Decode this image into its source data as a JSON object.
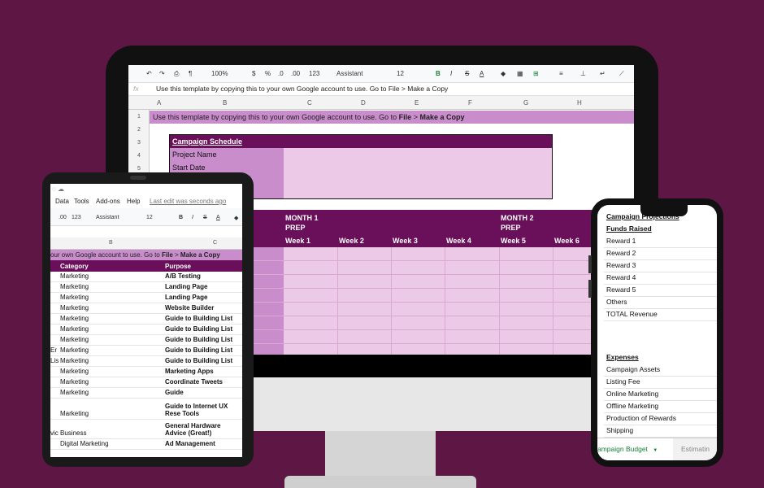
{
  "monitor": {
    "toolbar": {
      "zoom": "100%",
      "currency": "$",
      "percent": "%",
      "dec_decrease": ".0",
      "dec_increase": ".00",
      "format": "123",
      "font": "Assistant",
      "font_size": "12",
      "bold": "B",
      "italic": "I",
      "strike": "S",
      "text_color": "A"
    },
    "formula_bar": {
      "fx": "fx",
      "content": "Use this template by copying this to your own Google account to use.  Go to File > Make a Copy"
    },
    "columns": [
      "A",
      "B",
      "C",
      "D",
      "E",
      "F",
      "G",
      "H"
    ],
    "rows": [
      "1",
      "2",
      "3",
      "4",
      "5"
    ],
    "banner": {
      "text": "Use this template by copying this to your own Google account to use.  Go to ",
      "file": "File",
      "sep": " > ",
      "copy": "Make a Copy"
    },
    "schedule": {
      "title": "Campaign Schedule",
      "project_name": "Project Name",
      "start_date": "Start Date"
    },
    "months": {
      "month1": "MONTH 1",
      "prep": "PREP",
      "month2": "MONTH 2",
      "prep2": "PREP"
    },
    "weeks": [
      "Week 1",
      "Week 2",
      "Week 3",
      "Week 4",
      "Week 5",
      "Week 6"
    ]
  },
  "tablet": {
    "menu": [
      "Data",
      "Tools",
      "Add-ons",
      "Help"
    ],
    "last_edit": "Last edit was seconds ago",
    "toolbar": {
      "dec": ".00",
      "format": "123",
      "font": "Assistant",
      "size": "12",
      "bold": "B",
      "italic": "I",
      "strike": "S",
      "color": "A"
    },
    "columns": [
      "B",
      "C"
    ],
    "banner": {
      "text": "our own Google account to use.  Go to ",
      "file": "File",
      "sep": " > ",
      "copy": "Make a Copy"
    },
    "headers": {
      "category": "Category",
      "purpose": "Purpose"
    },
    "rows": [
      {
        "frag": "",
        "category": "Marketing",
        "purpose": "A/B Testing"
      },
      {
        "frag": "",
        "category": "Marketing",
        "purpose": "Landing Page"
      },
      {
        "frag": "",
        "category": "Marketing",
        "purpose": "Landing Page"
      },
      {
        "frag": "",
        "category": "Marketing",
        "purpose": "Website Builder"
      },
      {
        "frag": "",
        "category": "Marketing",
        "purpose": "Guide to Building List"
      },
      {
        "frag": "",
        "category": "Marketing",
        "purpose": "Guide to Building List"
      },
      {
        "frag": "",
        "category": "Marketing",
        "purpose": "Guide to Building List"
      },
      {
        "frag": "Er",
        "category": "Marketing",
        "purpose": "Guide to Building List"
      },
      {
        "frag": "Lis",
        "category": "Marketing",
        "purpose": "Guide to Building List"
      },
      {
        "frag": "",
        "category": "Marketing",
        "purpose": "Marketing Apps"
      },
      {
        "frag": "",
        "category": "Marketing",
        "purpose": "Coordinate Tweets"
      },
      {
        "frag": "",
        "category": "Marketing",
        "purpose": "Guide"
      },
      {
        "frag": "",
        "category": "Marketing",
        "purpose": "Guide to Internet UX Rese Tools"
      },
      {
        "frag": "vic",
        "category": "Business",
        "purpose": "General Hardware Advice (Great!)"
      },
      {
        "frag": "",
        "category": "Digital Marketing",
        "purpose": "Ad Management"
      }
    ]
  },
  "phone": {
    "title": "Campaign Projections",
    "funds_header": "Funds Raised",
    "funds": [
      "Reward 1",
      "Reward 2",
      "Reward 3",
      "Reward 4",
      "Reward 5",
      "Others",
      "TOTAL Revenue"
    ],
    "expenses_header": "Expenses",
    "expenses": [
      "Campaign Assets",
      "Listing Fee",
      "Online Marketing",
      "Offline Marketing",
      "Production of Rewards",
      "Shipping"
    ],
    "active_tab": "ampaign Budget",
    "tab_arrow": "▼",
    "other_tab": "Estimatin"
  },
  "colors": {
    "background": "#5e1645",
    "header_purple": "#6a0f5a",
    "mid_purple": "#c98dcc",
    "light_purple": "#ecc9e6"
  }
}
